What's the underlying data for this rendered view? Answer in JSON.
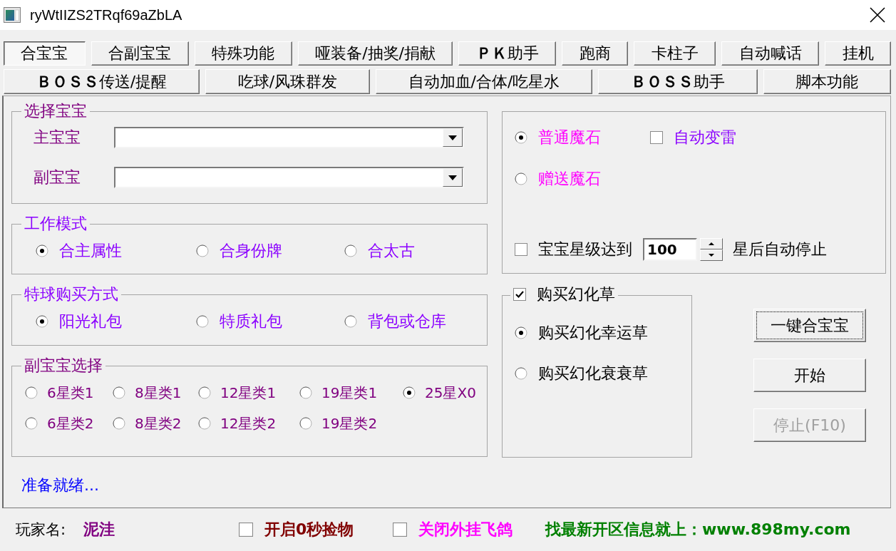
{
  "window": {
    "title": "ryWtIIZS2TRqf69aZbLA"
  },
  "tab_rows": [
    {
      "tabs": [
        {
          "label": "合宝宝",
          "selected": true
        },
        {
          "label": "合副宝宝",
          "selected": false
        },
        {
          "label": "特殊功能",
          "selected": false
        },
        {
          "label": "哑装备/抽奖/捐献",
          "selected": false
        },
        {
          "label": "**ＰＫ**助手",
          "selected": false
        },
        {
          "label": "跑商",
          "selected": false
        },
        {
          "label": "卡柱子",
          "selected": false
        },
        {
          "label": "自动喊话",
          "selected": false
        },
        {
          "label": "挂机",
          "selected": false
        }
      ]
    },
    {
      "tabs": [
        {
          "label": "**ＢＯＳＳ**传送/提醒",
          "selected": false
        },
        {
          "label": "吃球/风珠群发",
          "selected": false
        },
        {
          "label": "自动加血/合体/吃星水",
          "selected": false
        },
        {
          "label": "**ＢＯＳＳ**助手",
          "selected": false
        },
        {
          "label": "脚本功能",
          "selected": false
        }
      ]
    }
  ],
  "select_baby": {
    "title": "选择宝宝",
    "fields": [
      {
        "label": "主宝宝"
      },
      {
        "label": "副宝宝"
      }
    ]
  },
  "work_mode": {
    "title": "工作模式",
    "options": [
      {
        "label": "合主属性",
        "selected": true
      },
      {
        "label": "合身份牌",
        "selected": false
      },
      {
        "label": "合太古",
        "selected": false
      }
    ]
  },
  "special_ball_purchase": {
    "title": "特球购买方式",
    "options": [
      {
        "label": "阳光礼包",
        "selected": true
      },
      {
        "label": "特质礼包",
        "selected": false
      },
      {
        "label": "背包或仓库",
        "selected": false
      }
    ]
  },
  "sub_baby_selection": {
    "title": "副宝宝选择",
    "options": [
      {
        "label": "6星类1",
        "selected": false
      },
      {
        "label": "8星类1",
        "selected": false
      },
      {
        "label": "12星类1",
        "selected": false
      },
      {
        "label": "19星类1",
        "selected": false
      },
      {
        "label": "25星X0",
        "selected": true
      },
      {
        "label": "6星类2",
        "selected": false
      },
      {
        "label": "8星类2",
        "selected": false
      },
      {
        "label": "12星类2",
        "selected": false
      },
      {
        "label": "19星类2",
        "selected": false
      }
    ]
  },
  "status_text": "准备就绪...",
  "magic_stone": {
    "options": [
      {
        "label": "普通魔石",
        "selected": true
      },
      {
        "label": "赠送魔石",
        "selected": false
      }
    ],
    "auto_thunder": {
      "label": "自动变雷",
      "checked": false
    },
    "star_limit": {
      "label": "宝宝星级达到",
      "checked": false,
      "value": "100",
      "suffix": "星后自动停止"
    }
  },
  "buy_grass": {
    "label": "购买幻化草",
    "checked": true,
    "options": [
      {
        "label": "购买幻化幸运草",
        "selected": true
      },
      {
        "label": "购买幻化衰衰草",
        "selected": false
      }
    ]
  },
  "buttons": [
    {
      "label": "一键合宝宝",
      "focused": true,
      "disabled": false
    },
    {
      "label": "开始",
      "focused": false,
      "disabled": false
    },
    {
      "label": "停止(F10)",
      "focused": false,
      "disabled": true
    }
  ],
  "footer": {
    "player_label": "玩家名:",
    "player_name": "泥洼",
    "options": [
      {
        "label": "开启0秒捡物",
        "checked": false,
        "color": "#800000"
      },
      {
        "label": "关闭外挂飞鸽",
        "checked": false,
        "color": "#ff00ff"
      }
    ],
    "promo": "找最新开区信息就上：www.898my.com"
  }
}
